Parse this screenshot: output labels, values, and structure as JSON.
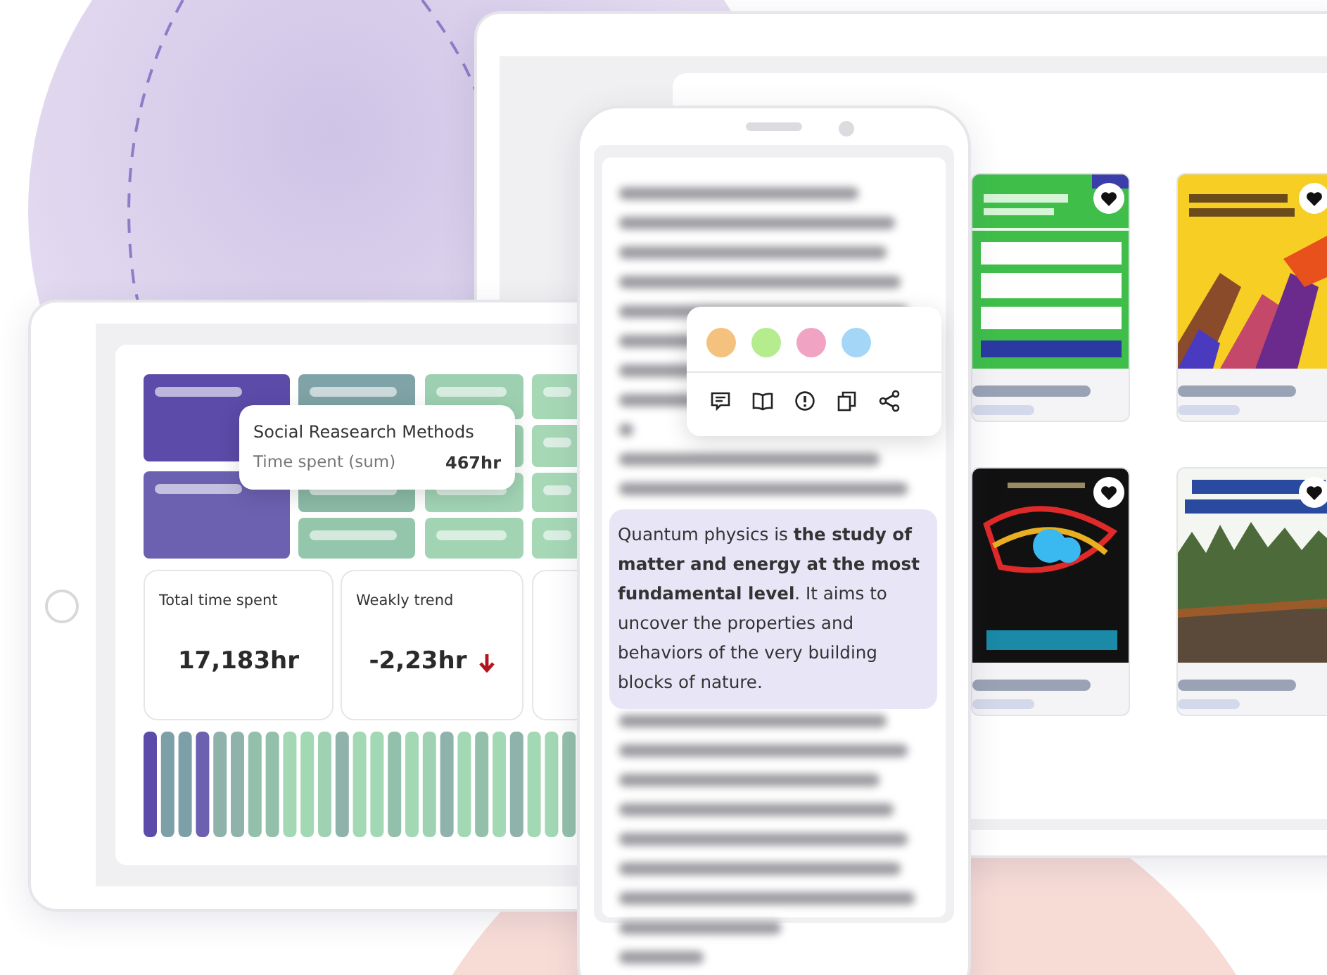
{
  "dashboard": {
    "tooltip": {
      "title": "Social Reasearch Methods",
      "label": "Time spent (sum)",
      "value": "467hr"
    },
    "stats": [
      {
        "label": "Total time spent",
        "value": "17,183hr"
      },
      {
        "label": "Weakly trend",
        "value": "-2,23hr",
        "falling": true
      }
    ]
  },
  "reader": {
    "highlight_colors": [
      {
        "color": "#f4c27e"
      },
      {
        "color": "#b5ec8e"
      },
      {
        "color": "#f0a3c3"
      },
      {
        "color": "#a3d6f7"
      }
    ],
    "tools": [
      {
        "kind": "note"
      },
      {
        "kind": "book"
      },
      {
        "kind": "info"
      },
      {
        "kind": "copy"
      },
      {
        "kind": "share"
      }
    ],
    "passage": "Quantum physics is **the study of matter and energy at the most fundamental level**. It aims to uncover the properties and behaviors of the very building blocks of nature."
  },
  "library": {
    "books": [
      {
        "kind": "picture",
        "favorite": true
      },
      {
        "kind": "picture",
        "favorite": true
      },
      {
        "kind": "picture",
        "favorite": true
      },
      {
        "kind": "picture",
        "favorite": true
      }
    ]
  }
}
